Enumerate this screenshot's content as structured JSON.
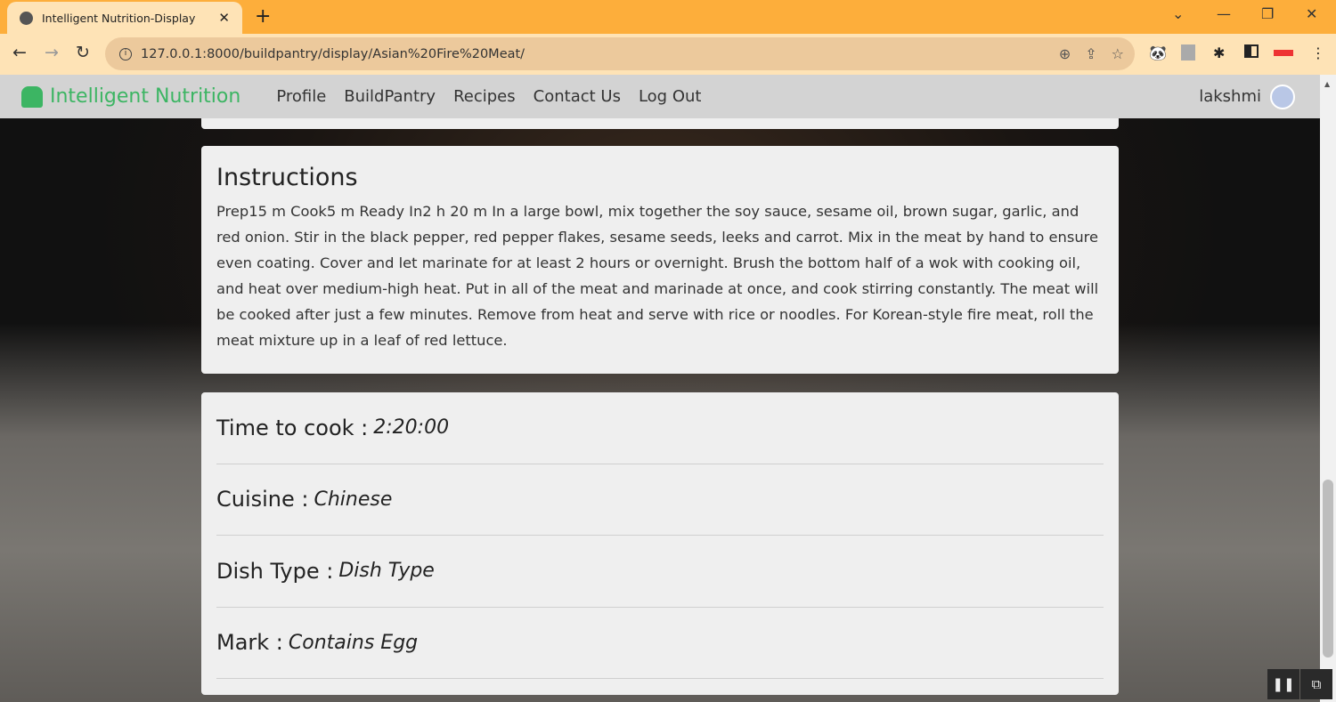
{
  "browser": {
    "tab_title": "Intelligent Nutrition-Display",
    "url": "127.0.0.1:8000/buildpantry/display/Asian%20Fire%20Meat/"
  },
  "navbar": {
    "brand": "Intelligent Nutrition",
    "links": [
      "Profile",
      "BuildPantry",
      "Recipes",
      "Contact Us",
      "Log Out"
    ],
    "user": "lakshmi"
  },
  "instructions": {
    "heading": "Instructions",
    "text": "Prep15 m Cook5 m Ready In2 h 20 m In a large bowl, mix together the soy sauce, sesame oil, brown sugar, garlic, and red onion. Stir in the black pepper, red pepper flakes, sesame seeds, leeks and carrot. Mix in the meat by hand to ensure even coating. Cover and let marinate for at least 2 hours or overnight. Brush the bottom half of a wok with cooking oil, and heat over medium-high heat. Put in all of the meat and marinade at once, and cook stirring constantly. The meat will be cooked after just a few minutes. Remove from heat and serve with rice or noodles. For Korean-style fire meat, roll the meat mixture up in a leaf of red lettuce."
  },
  "details": [
    {
      "label": "Time to cook :",
      "value": "2:20:00"
    },
    {
      "label": "Cuisine :",
      "value": "Chinese"
    },
    {
      "label": "Dish Type :",
      "value": "Dish Type"
    },
    {
      "label": "Mark :",
      "value": "Contains Egg"
    }
  ],
  "colors": {
    "brand": "#3cb563",
    "tabbar": "#fdae3b"
  }
}
